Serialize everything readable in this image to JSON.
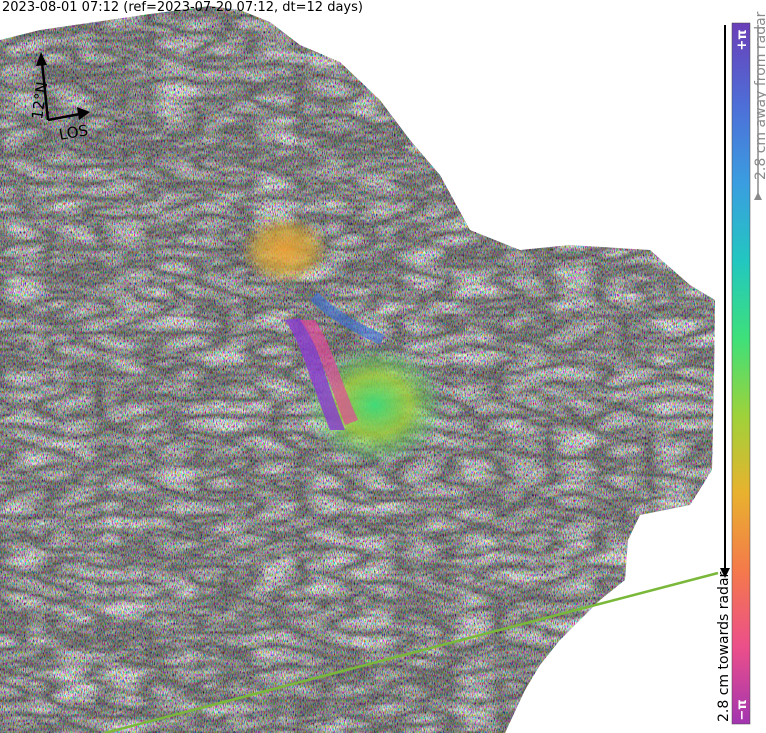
{
  "title": "2023-08-01 07:12 (ref=2023-07-20 07:12, dt=12 days)",
  "north_arrow": {
    "heading_label": "12°N",
    "los_label": "LOS"
  },
  "colorbar": {
    "top_label": "+π",
    "bottom_label": "−π",
    "upper_caption": "2.8 cm away from radar",
    "lower_caption": "2.8 cm towards radar",
    "colors": [
      "#6a3fb8",
      "#4d6fd8",
      "#3a9ee0",
      "#22c7c0",
      "#3ee07a",
      "#9ed23a",
      "#e8b22e",
      "#f47a4a",
      "#ec4f8a",
      "#a235b0"
    ]
  },
  "colors": {
    "track_line": "#7ab83a",
    "text": "#000000",
    "caption_gray": "#8a8a8a"
  }
}
